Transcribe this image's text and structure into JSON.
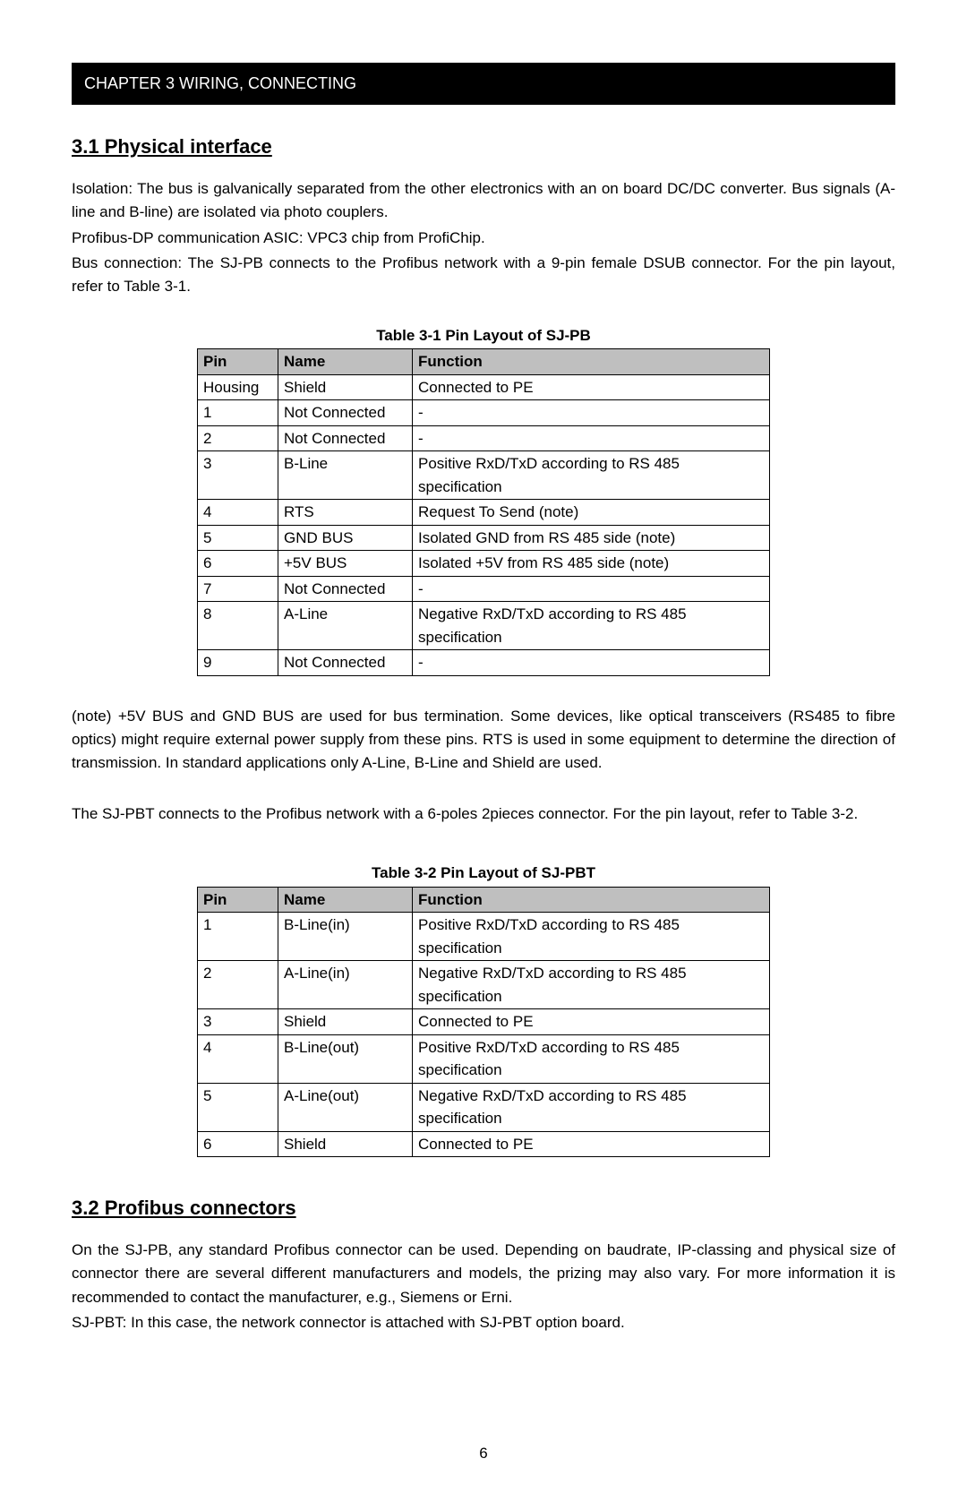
{
  "chapterHeader": "CHAPTER 3    WIRING, CONNECTING",
  "section31": {
    "heading": "3.1 Physical interface",
    "para1": "Isolation: The bus is galvanically separated from the other electronics with an on board DC/DC converter. Bus signals (A-line and B-line) are isolated via photo couplers.",
    "para2": "Profibus-DP communication ASIC: VPC3 chip from ProfiChip.",
    "para3": "Bus connection: The SJ-PB connects to the Profibus network with a 9-pin female DSUB connector. For the pin layout, refer to Table 3-1."
  },
  "table31": {
    "caption": "Table 3-1 Pin Layout of SJ-PB",
    "head": {
      "pin": "Pin",
      "name": "Name",
      "function": "Function"
    },
    "rows": [
      {
        "pin": "Housing",
        "name": "Shield",
        "function": "Connected to PE"
      },
      {
        "pin": "1",
        "name": "Not Connected",
        "function": "-"
      },
      {
        "pin": "2",
        "name": "Not Connected",
        "function": "-"
      },
      {
        "pin": "3",
        "name": "B-Line",
        "function": "Positive RxD/TxD according to RS 485 specification"
      },
      {
        "pin": "4",
        "name": "RTS",
        "function": "Request To Send (note)"
      },
      {
        "pin": "5",
        "name": "GND BUS",
        "function": "Isolated GND from RS 485 side (note)"
      },
      {
        "pin": "6",
        "name": "+5V BUS",
        "function": "Isolated +5V from RS 485 side (note)"
      },
      {
        "pin": "7",
        "name": "Not Connected",
        "function": "-"
      },
      {
        "pin": "8",
        "name": "A-Line",
        "function": "Negative RxD/TxD according to RS 485 specification"
      },
      {
        "pin": "9",
        "name": "Not Connected",
        "function": "-"
      }
    ]
  },
  "note1": "(note) +5V BUS and GND BUS are used for bus termination. Some devices, like optical transceivers (RS485 to fibre optics) might require external power supply from these pins. RTS is used in some equipment to determine the direction of transmission. In standard applications only A-Line, B-Line and Shield are used.",
  "note2": "The SJ-PBT connects to the Profibus network with a 6-poles 2pieces connector. For the pin layout, refer to Table 3-2.",
  "table32": {
    "caption": "Table 3-2 Pin Layout of SJ-PBT",
    "head": {
      "pin": "Pin",
      "name": "Name",
      "function": "Function"
    },
    "rows": [
      {
        "pin": "1",
        "name": "B-Line(in)",
        "function": "Positive RxD/TxD according to RS 485 specification"
      },
      {
        "pin": "2",
        "name": "A-Line(in)",
        "function": "Negative RxD/TxD according to RS 485 specification"
      },
      {
        "pin": "3",
        "name": "Shield",
        "function": "Connected to PE"
      },
      {
        "pin": "4",
        "name": "B-Line(out)",
        "function": "Positive RxD/TxD according to RS 485 specification"
      },
      {
        "pin": "5",
        "name": "A-Line(out)",
        "function": "Negative RxD/TxD according to RS 485 specification"
      },
      {
        "pin": "6",
        "name": "Shield",
        "function": "Connected to PE"
      }
    ]
  },
  "section32": {
    "heading": "3.2 Profibus connectors",
    "para1": "On the SJ-PB, any standard Profibus connector can be used. Depending on baudrate, IP-classing and physical size of connector there are several different manufacturers and models, the prizing may also vary. For more information it is recommended to contact the manufacturer, e.g., Siemens or Erni.",
    "para2": "SJ-PBT: In this case, the network connector is attached with SJ-PBT option board."
  },
  "pageNumber": "6"
}
